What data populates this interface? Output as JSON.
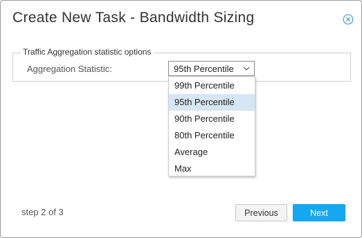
{
  "dialog": {
    "title": "Create New Task - Bandwidth Sizing",
    "close_icon": "close-circle-icon"
  },
  "fieldset": {
    "legend": "Traffic Aggregation statistic options",
    "aggregation_label": "Aggregation Statistic:",
    "select": {
      "value": "95th Percentile",
      "icon": "chevron-down-icon",
      "expanded": true,
      "options": [
        {
          "label": "99th Percentile"
        },
        {
          "label": "95th Percentile",
          "selected": true
        },
        {
          "label": "90th Percentile"
        },
        {
          "label": "80th Percentile"
        },
        {
          "label": "Average"
        },
        {
          "label": "Max"
        }
      ]
    }
  },
  "footer": {
    "step_text": "step 2 of 3",
    "previous_label": "Previous",
    "next_label": "Next"
  },
  "colors": {
    "primary_button": "#15a8f1",
    "close_icon": "#4a9ad8",
    "selected_option": "#d6e6f4"
  }
}
